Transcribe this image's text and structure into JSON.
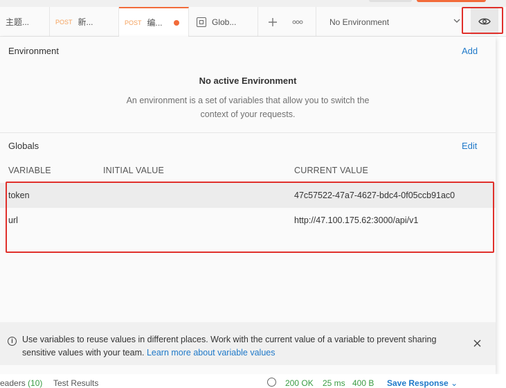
{
  "tabs": [
    {
      "label": "主题..."
    },
    {
      "method": "POST",
      "label": "新..."
    },
    {
      "method": "POST",
      "label": "编..."
    },
    {
      "label": "Glob..."
    }
  ],
  "tabbar": {
    "new_tab_icon": "plus-icon",
    "more_icon": "ellipsis-icon",
    "environment_selected": "No Environment",
    "eye_icon": "eye-icon"
  },
  "environment": {
    "title": "Environment",
    "add_label": "Add",
    "empty_title": "No active Environment",
    "empty_description": "An environment is a set of variables that allow you to switch the context of your requests."
  },
  "globals": {
    "title": "Globals",
    "edit_label": "Edit",
    "columns": [
      "VARIABLE",
      "INITIAL VALUE",
      "CURRENT VALUE"
    ],
    "rows": [
      {
        "variable": "token",
        "initial_value": "",
        "current_value": "47c57522-47a7-4627-bdc4-0f05ccb91ac0"
      },
      {
        "variable": "url",
        "initial_value": "",
        "current_value": "http://47.100.175.62:3000/api/v1"
      }
    ]
  },
  "info_banner": {
    "text": "Use variables to reuse values in different places. Work with the current value of a variable to prevent sharing sensitive values with your team.",
    "link": "Learn more about variable values"
  },
  "bottom_bar": {
    "headers_label": "eaders",
    "headers_count": "(10)",
    "test_results": "Test Results",
    "status": "200 OK",
    "time": "25 ms",
    "size": "400 B",
    "save_response": "Save Response"
  },
  "colors": {
    "accent": "#f26b3a",
    "link": "#1f79c9",
    "highlight": "#e0302b",
    "success": "#3a9c43"
  }
}
